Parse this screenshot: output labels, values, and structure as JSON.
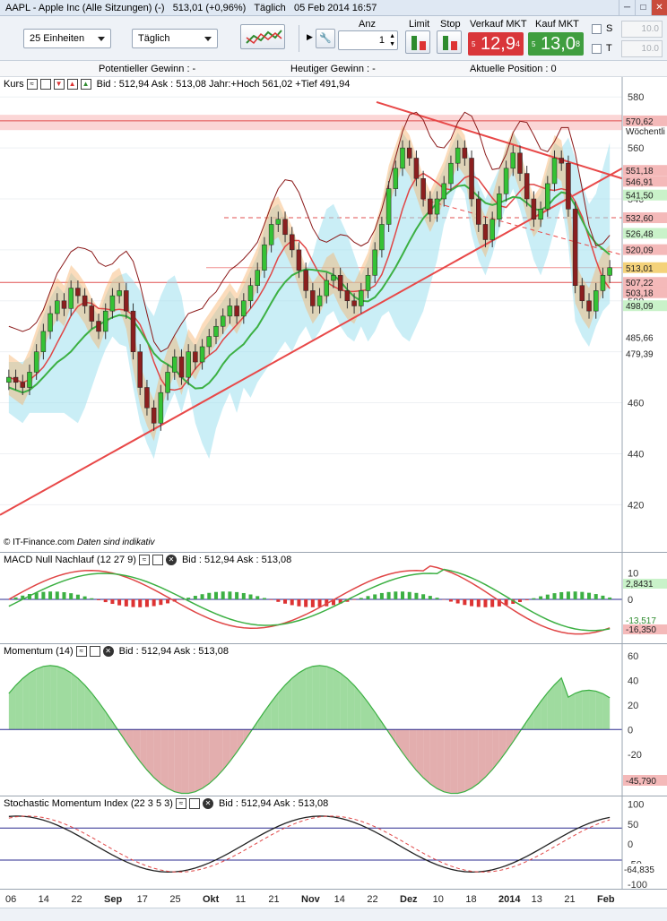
{
  "window": {
    "title": "AAPL - Apple Inc (Alle Sitzungen) (-)",
    "last": "513,01 (+0,96%)",
    "period": "Täglich",
    "date": "05 Feb 2014 16:57"
  },
  "toolbar": {
    "units_select": "25 Einheiten",
    "period_select": "Täglich",
    "anz_label": "Anz",
    "anz_value": "1",
    "limit_label": "Limit",
    "stop_label": "Stop",
    "sell_label": "Verkauf MKT",
    "buy_label": "Kauf MKT",
    "sell_prefix": "5",
    "sell_price": "12,9",
    "sell_sup": "4",
    "buy_prefix": "5",
    "buy_price": "13,0",
    "buy_sup": "8",
    "s_label": "S",
    "t_label": "T",
    "s_value": "10.0",
    "t_value": "10.0",
    "sell_color": "#d9363a",
    "buy_color": "#3f9e3f"
  },
  "infobar": {
    "potential": "Potentieller Gewinn : -",
    "today": "Heutiger Gewinn : -",
    "position": "Aktuelle Position : 0"
  },
  "price_panel": {
    "label": "Kurs",
    "info": "Bid : 512,94 Ask : 513,08 Jahr:+Hoch 561,02 +Tief 491,94",
    "footer": "© IT-Finance.com",
    "footer_note": "Daten sind indikativ"
  },
  "macd_panel": {
    "label": "MACD Null Nachlauf (12 27 9)",
    "info": "Bid : 512,94 Ask : 513,08"
  },
  "momentum_panel": {
    "label": "Momentum (14)",
    "info": "Bid : 512,94 Ask : 513,08"
  },
  "smi_panel": {
    "label": "Stochastic Momentum Index (22 3 5 3)",
    "info": "Bid : 512,94 Ask : 513,08"
  },
  "chart_data": [
    {
      "type": "candlestick",
      "title": "Kurs",
      "ylim": [
        405,
        585
      ],
      "yticks": [
        "580",
        "560",
        "540",
        "520",
        "500",
        "480",
        "460",
        "440",
        "420"
      ],
      "price_labels": [
        {
          "value": 570.62,
          "text": "570,62",
          "sub": "Wöchentli",
          "color": "#f4b9b9"
        },
        {
          "value": 551.18,
          "text": "551,18",
          "color": "#f4b9b9"
        },
        {
          "value": 546.91,
          "text": "546,91",
          "color": "#f4b9b9"
        },
        {
          "value": 541.5,
          "text": "541,50",
          "color": "#c9f2c9"
        },
        {
          "value": 532.6,
          "text": "532,60",
          "color": "#f4b9b9"
        },
        {
          "value": 526.48,
          "text": "526,48",
          "color": "#c9f2c9"
        },
        {
          "value": 520.09,
          "text": "520,09",
          "color": "#f4b9b9"
        },
        {
          "value": 513.01,
          "text": "513,01",
          "color": "#f4d27a"
        },
        {
          "value": 507.22,
          "text": "507,22",
          "color": "#f4b9b9"
        },
        {
          "value": 503.18,
          "text": "503,18",
          "color": "#f4b9b9"
        },
        {
          "value": 498.09,
          "text": "498,09",
          "color": "#c9f2c9"
        },
        {
          "value": 485.66,
          "text": "485,66",
          "color": "#ffffff"
        },
        {
          "value": 479.39,
          "text": "479,39",
          "color": "#ffffff"
        }
      ],
      "closes": [
        470,
        468,
        466,
        472,
        480,
        488,
        495,
        500,
        497,
        505,
        502,
        498,
        492,
        488,
        496,
        502,
        504,
        496,
        480,
        466,
        458,
        452,
        464,
        472,
        478,
        470,
        480,
        476,
        482,
        486,
        490,
        494,
        498,
        494,
        500,
        506,
        512,
        522,
        530,
        532,
        526,
        520,
        512,
        504,
        498,
        502,
        508,
        510,
        504,
        500,
        498,
        504,
        510,
        520,
        530,
        544,
        552,
        560,
        556,
        548,
        540,
        534,
        540,
        546,
        554,
        560,
        556,
        540,
        530,
        524,
        532,
        542,
        552,
        558,
        550,
        540,
        532,
        536,
        546,
        556,
        554,
        536,
        506,
        500,
        496,
        504,
        510,
        513.01
      ]
    },
    {
      "type": "bar+line",
      "title": "MACD Null Nachlauf (12 27 9)",
      "ylim": [
        -15,
        15
      ],
      "yticks": [
        "10",
        "0",
        "-10"
      ],
      "last_values": [
        "2,8431",
        "-13,517",
        "-16,350"
      ]
    },
    {
      "type": "area",
      "title": "Momentum (14)",
      "ylim": [
        -50,
        65
      ],
      "yticks": [
        "60",
        "40",
        "20",
        "0",
        "-20",
        "-40"
      ],
      "last_value": "-45,790"
    },
    {
      "type": "line",
      "title": "Stochastic Momentum Index (22 3 5 3)",
      "ylim": [
        -105,
        110
      ],
      "yticks": [
        "100",
        "50",
        "0",
        "-50",
        "-100"
      ],
      "last_value": "-64,835"
    },
    {
      "type": "axis",
      "xticks": [
        "06",
        "14",
        "22",
        "Sep",
        "17",
        "25",
        "Okt",
        "11",
        "21",
        "Nov",
        "14",
        "22",
        "Dez",
        "10",
        "18",
        "2014",
        "13",
        "21",
        "Feb"
      ]
    }
  ]
}
